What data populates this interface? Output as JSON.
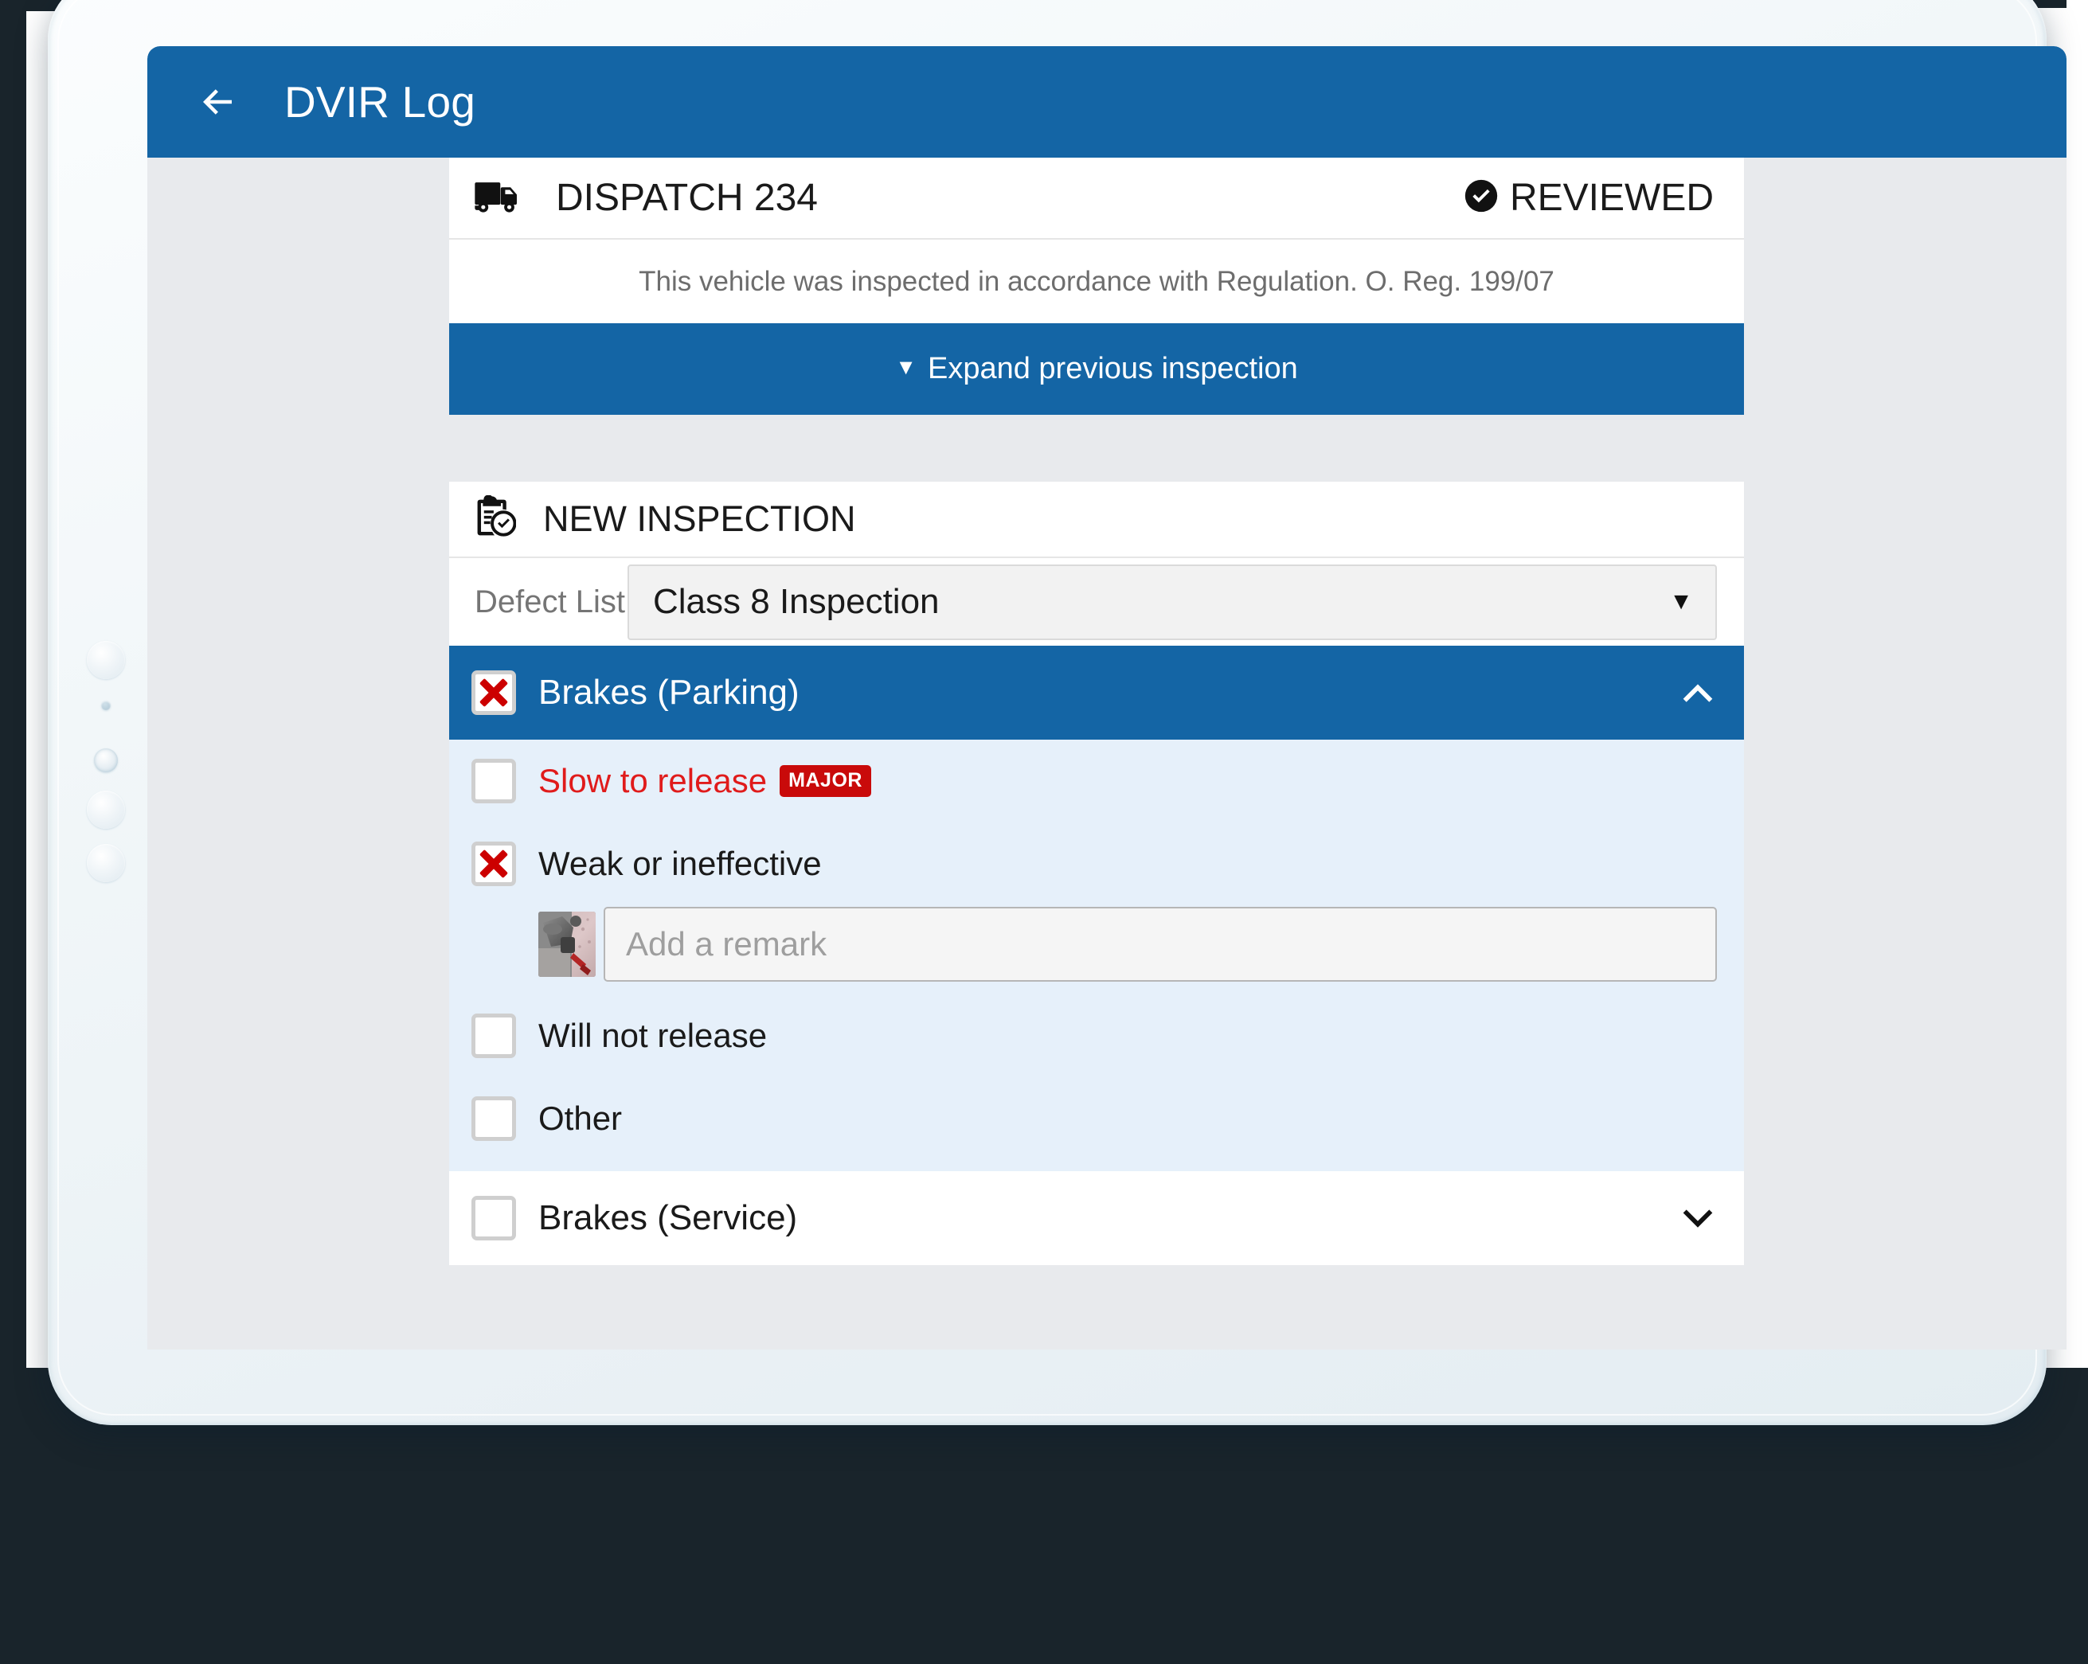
{
  "appbar": {
    "back_icon": "arrow-left-icon",
    "title": "DVIR Log"
  },
  "dispatch": {
    "truck_icon": "truck-icon",
    "title": "DISPATCH 234",
    "status_icon": "check-circle-icon",
    "status": "REVIEWED",
    "regulation_note": "This vehicle was inspected in accordance with Regulation. O. Reg. 199/07"
  },
  "expand_button": {
    "caret": "▼",
    "label": "Expand previous inspection"
  },
  "inspection": {
    "icon": "clipboard-check-icon",
    "title": "NEW INSPECTION",
    "defect_list_label": "Defect List",
    "defect_list_value": "Class 8 Inspection",
    "defect_list_caret": "▼"
  },
  "groups": [
    {
      "label": "Brakes (Parking)",
      "checked": true,
      "expanded": true,
      "chevron_icon": "chevron-up-icon",
      "items": [
        {
          "label": "Slow to release",
          "checked": false,
          "severity_badge": "MAJOR",
          "is_major": true,
          "has_remark": false
        },
        {
          "label": "Weak or ineffective",
          "checked": true,
          "severity_badge": "",
          "is_major": false,
          "has_remark": true,
          "remark_placeholder": "Add a remark",
          "photo_thumbnail": "brake-hardware-photo"
        },
        {
          "label": "Will not release",
          "checked": false,
          "severity_badge": "",
          "is_major": false,
          "has_remark": false
        },
        {
          "label": "Other",
          "checked": false,
          "severity_badge": "",
          "is_major": false,
          "has_remark": false
        }
      ]
    },
    {
      "label": "Brakes (Service)",
      "checked": false,
      "expanded": false,
      "chevron_icon": "chevron-down-icon",
      "items": []
    }
  ],
  "colors": {
    "primary_blue": "#1465a5",
    "page_background": "#e8eaed",
    "group_body_blue": "#e6f0fa",
    "major_red": "#c90a0a",
    "defect_red_text": "#e01b1b",
    "checkbox_x_red": "#cc0000",
    "backdrop_dark": "#19242b"
  }
}
